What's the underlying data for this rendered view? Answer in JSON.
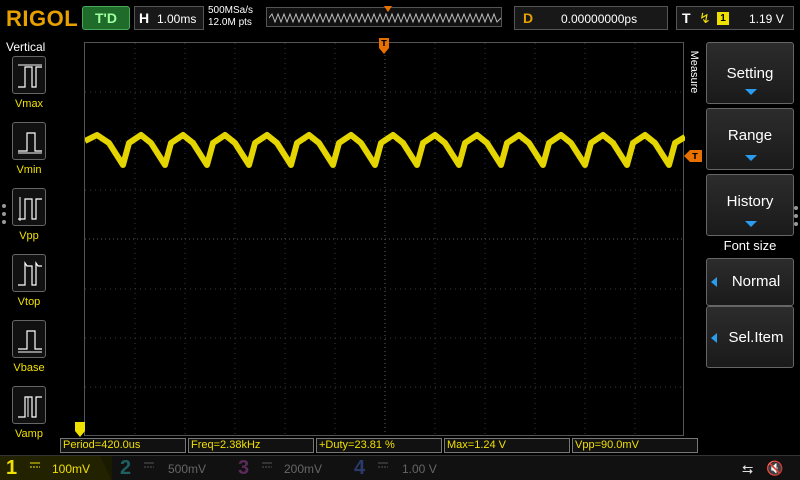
{
  "topbar": {
    "brand": "RIGOL",
    "trigger_state": "T'D",
    "horizontal": {
      "label": "H",
      "value": "1.00ms"
    },
    "sample_rate": "500MSa/s",
    "memory_depth": "12.0M pts",
    "delay": {
      "label": "D",
      "value": "0.00000000ps"
    },
    "trigger": {
      "label": "T",
      "edge": "rising-edge-icon",
      "source": "1",
      "level": "1.19 V"
    }
  },
  "left_menu": {
    "title": "Vertical",
    "items": [
      {
        "label": "Vmax"
      },
      {
        "label": "Vmin"
      },
      {
        "label": "Vpp"
      },
      {
        "label": "Vtop"
      },
      {
        "label": "Vbase"
      },
      {
        "label": "Vamp"
      }
    ]
  },
  "measure_tab": "Measure",
  "right_menu": {
    "setting": "Setting",
    "range": "Range",
    "history": "History",
    "font_size_title": "Font size",
    "font_size_value": "Normal",
    "sel_item": "Sel.Item"
  },
  "measurements": [
    "Period=420.0us",
    "Freq=2.38kHz",
    "+Duty=23.81 %",
    "Max=1.24 V",
    "Vpp=90.0mV"
  ],
  "channels": [
    {
      "num": "1",
      "scale": "100mV",
      "color": "#f0e000",
      "active": true
    },
    {
      "num": "2",
      "scale": "500mV",
      "color": "#00c8c8",
      "active": false
    },
    {
      "num": "3",
      "scale": "200mV",
      "color": "#d040d0",
      "active": false
    },
    {
      "num": "4",
      "scale": "1.00 V",
      "color": "#3a7ff0",
      "active": false
    }
  ],
  "colors": {
    "ch1": "#f0e000",
    "brand": "#e8a000",
    "trigger_marker": "#e87000",
    "menu_accent": "#2a9cf0"
  }
}
